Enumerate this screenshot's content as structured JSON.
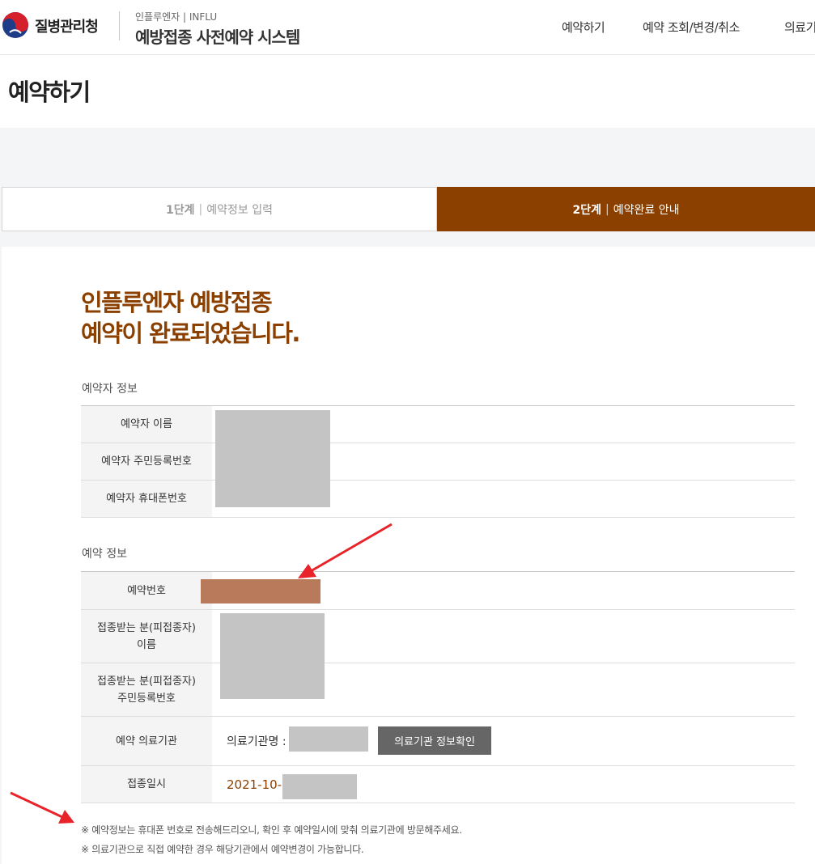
{
  "header": {
    "agency": "질병관리청",
    "system_subtitle": "인플루엔자 | INFLU",
    "system_title": "예방접종 사전예약 시스템",
    "nav": [
      "예약하기",
      "예약 조회/변경/취소",
      "의료기"
    ]
  },
  "page_title": "예약하기",
  "steps": [
    {
      "num": "1단계",
      "label": "예약정보 입력",
      "active": false
    },
    {
      "num": "2단계",
      "label": "예약완료 안내",
      "active": true
    }
  ],
  "completion": {
    "line1": "인플루엔자 예방접종",
    "line2": "예약이 완료되었습니다."
  },
  "reserver_section": {
    "title": "예약자 정보",
    "rows": [
      "예약자 이름",
      "예약자 주민등록번호",
      "예약자 휴대폰번호"
    ]
  },
  "reservation_section": {
    "title": "예약 정보",
    "number_label": "예약번호",
    "recipient_name_label_1": "접종받는 분(피접종자)",
    "recipient_name_label_2": "이름",
    "recipient_id_label_1": "접종받는 분(피접종자)",
    "recipient_id_label_2": "주민등록번호",
    "institution_label": "예약 의료기관",
    "institution_name_label": "의료기관명 :",
    "institution_button": "의료기관 정보확인",
    "date_label": "접종일시",
    "date_value": "2021-10-"
  },
  "notes": [
    "※ 예약정보는 휴대폰 번호로 전송해드리오니, 확인 후 예약일시에 맞춰 의료기관에 방문해주세요.",
    "※ 의료기관으로 직접 예약한 경우 해당기관에서 예약변경이 가능합니다."
  ],
  "colors": {
    "accent": "#8b4000",
    "masked_blur": "#c4c4c4",
    "highlight_mask": "#b87a5b",
    "annotation_arrow": "#e8232a"
  }
}
